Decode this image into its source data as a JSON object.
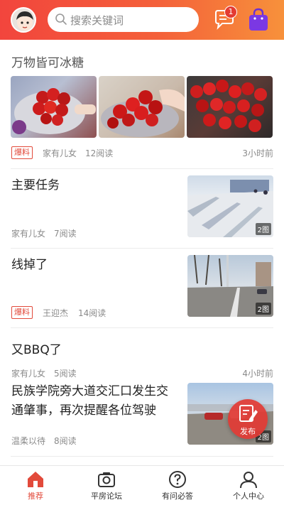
{
  "header": {
    "search_placeholder": "搜索关键词",
    "message_badge": "1",
    "accent_gradient": [
      "#f2453d",
      "#f7913b"
    ],
    "icons": [
      "avatar",
      "search-icon",
      "message-icon",
      "shopping-bag-icon"
    ]
  },
  "feed": {
    "section_title": "万物皆可冰糖",
    "post1": {
      "tag": "爆料",
      "author": "家有儿女",
      "reads": "12阅读",
      "time": "3小时前"
    },
    "post2": {
      "title": "主要任务",
      "author": "家有儿女",
      "reads": "7阅读",
      "image_count": "2图"
    },
    "post3": {
      "title": "线掉了",
      "tag": "爆料",
      "author": "王迎杰",
      "reads": "14阅读",
      "image_count": "2图"
    },
    "post4": {
      "title": "又BBQ了",
      "author": "家有儿女",
      "reads": "5阅读",
      "time": "4小时前"
    },
    "post5": {
      "title_line1": "民族学院旁大道交汇口发生交",
      "title_line2": "通肇事，再次提醒各位驾驶",
      "author": "温柔以待",
      "reads": "8阅读",
      "image_count": "2图"
    }
  },
  "publish": {
    "label": "发布",
    "color": "#e23a34"
  },
  "bottom_nav": {
    "items": [
      {
        "label": "推荐",
        "active": true
      },
      {
        "label": "平房论坛",
        "active": false
      },
      {
        "label": "有问必答",
        "active": false
      },
      {
        "label": "个人中心",
        "active": false
      }
    ],
    "active_color": "#e24a3b"
  }
}
